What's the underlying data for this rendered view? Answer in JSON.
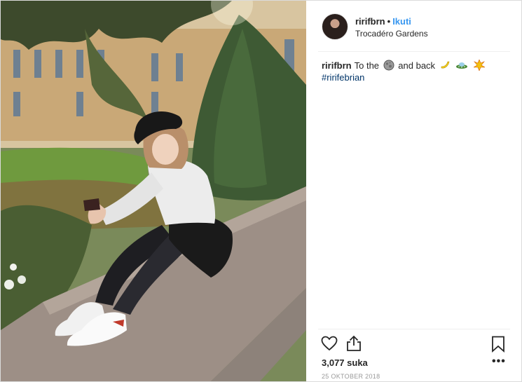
{
  "post": {
    "author": {
      "username": "ririfbrn",
      "follow_label": "Ikuti",
      "location": "Trocadéro Gardens"
    },
    "caption": {
      "username": "ririfbrn",
      "text_before": "To the",
      "text_after": "and back",
      "hashtag": "#ririfebrian"
    },
    "likes": "3,077 suka",
    "date": "25 OKTOBER 2018",
    "more_label": "•••"
  },
  "icons": {
    "moon": "full-moon-emoji",
    "banana": "banana-emoji",
    "ufo": "flying-saucer-emoji",
    "sparkle": "collision-emoji",
    "heart": "heart-icon",
    "share": "share-icon",
    "bookmark": "bookmark-icon"
  },
  "colors": {
    "link_blue": "#3897f0",
    "hashtag_blue": "#003569",
    "border": "#dbdbdb",
    "text": "#262626",
    "muted": "#999999"
  }
}
